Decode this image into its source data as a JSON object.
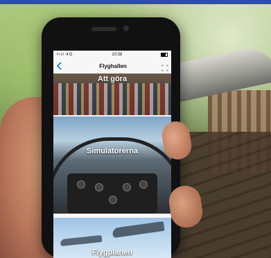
{
  "status_bar": {
    "signal": "•ııl 4G",
    "time": "10:38"
  },
  "nav": {
    "title": "Flyghallen",
    "back_icon": "chevron-left-icon",
    "expand_icon": "expand-icon"
  },
  "cards": [
    {
      "label": "Att göra"
    },
    {
      "label": "Simulatorerna"
    },
    {
      "label": "Flygplanen"
    }
  ],
  "colors": {
    "accent": "#0a7aff",
    "top_bar": "#2b4fa8"
  }
}
